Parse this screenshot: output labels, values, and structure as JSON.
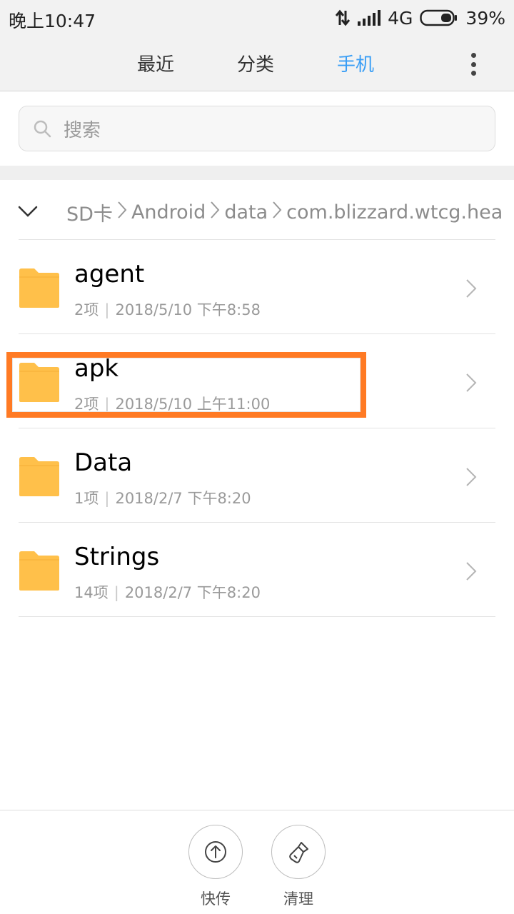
{
  "status_bar": {
    "time": "晚上10:47",
    "network": "4G",
    "battery": "39%",
    "icons": [
      "data-transfer-icon",
      "signal-icon",
      "battery-icon"
    ]
  },
  "tabs": [
    {
      "label": "最近",
      "active": false
    },
    {
      "label": "分类",
      "active": false
    },
    {
      "label": "手机",
      "active": true
    }
  ],
  "colors": {
    "accent": "#3a9ef5",
    "folder": "#ffc04a",
    "highlight": "#ff7a24"
  },
  "search": {
    "placeholder": "搜索"
  },
  "breadcrumb": {
    "segments": [
      "SD卡",
      "Android",
      "data",
      "com.blizzard.wtcg.hear"
    ]
  },
  "files": [
    {
      "name": "agent",
      "count": "2项",
      "date": "2018/5/10 下午8:58"
    },
    {
      "name": "apk",
      "count": "2项",
      "date": "2018/5/10 上午11:00"
    },
    {
      "name": "Data",
      "count": "1项",
      "date": "2018/2/7 下午8:20"
    },
    {
      "name": "Strings",
      "count": "14项",
      "date": "2018/2/7 下午8:20"
    }
  ],
  "bottom_actions": [
    {
      "label": "快传",
      "icon": "upload-icon"
    },
    {
      "label": "清理",
      "icon": "brush-icon"
    }
  ]
}
